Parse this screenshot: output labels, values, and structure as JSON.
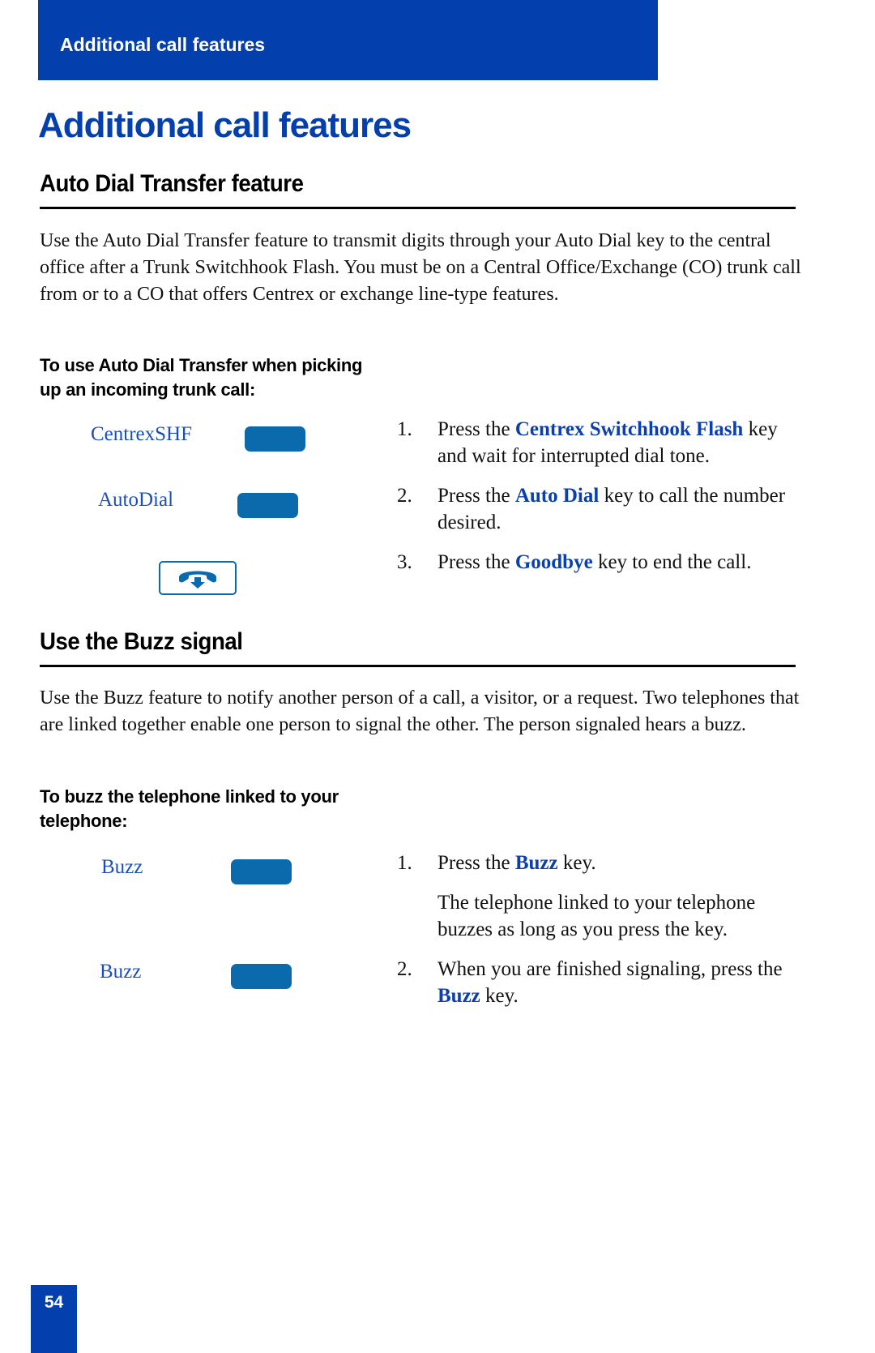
{
  "header": {
    "running_title": "Additional call features"
  },
  "page_title": "Additional call features",
  "sections": [
    {
      "heading": "Auto Dial Transfer feature",
      "intro": "Use the Auto Dial Transfer feature to transmit digits through your Auto Dial key to the central office after a Trunk Switchhook Flash. You must be on a Central Office/Exchange (CO) trunk call from or to a CO that offers Centrex or exchange line-type features.",
      "procedure_heading": "To use Auto Dial Transfer when picking up an incoming trunk call:",
      "keys": [
        {
          "label": "CentrexSHF",
          "icon": "key-button"
        },
        {
          "label": "AutoDial",
          "icon": "key-button"
        },
        {
          "label": "",
          "icon": "goodbye-handset-icon"
        }
      ],
      "steps": [
        {
          "num": "1.",
          "pre": "Press the ",
          "key": "Centrex Switchhook Flash",
          "post": " key and wait for interrupted dial tone."
        },
        {
          "num": "2.",
          "pre": "Press the ",
          "key": "Auto Dial",
          "post": " key to call the number desired."
        },
        {
          "num": "3.",
          "pre": "Press the ",
          "key": "Goodbye",
          "post": " key to end the call."
        }
      ]
    },
    {
      "heading": "Use the Buzz signal",
      "intro": "Use the Buzz feature to notify another person of a call, a visitor, or a request. Two telephones that are linked together enable one person to signal the other. The person signaled hears a buzz.",
      "procedure_heading": "To buzz the telephone linked to your telephone:",
      "keys": [
        {
          "label": "Buzz",
          "icon": "key-button"
        },
        {
          "label": "Buzz",
          "icon": "key-button"
        }
      ],
      "steps": [
        {
          "num": "1.",
          "pre": "Press the ",
          "key": "Buzz",
          "post": " key.",
          "note": "The telephone linked to your telephone buzzes as long as you press the key."
        },
        {
          "num": "2.",
          "pre": "When you are finished signaling, press the ",
          "key": "Buzz",
          "post": " key."
        }
      ]
    }
  ],
  "footer": {
    "page_number": "54"
  },
  "colors": {
    "brand_blue": "#0340ad",
    "key_blue": "#0a6aab",
    "highlight_text": "#0b3fae"
  }
}
